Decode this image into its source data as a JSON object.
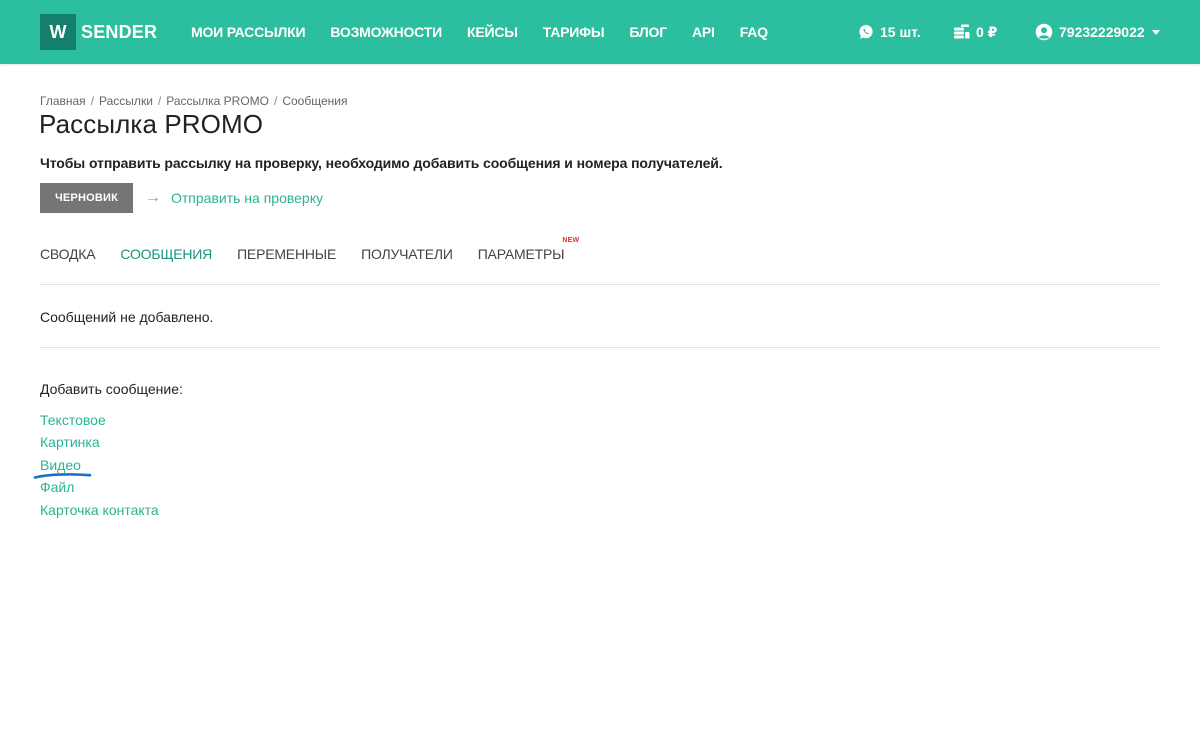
{
  "brand": {
    "logo_letter": "W",
    "name": "SENDER"
  },
  "nav": [
    {
      "label": "МОИ РАССЫЛКИ"
    },
    {
      "label": "ВОЗМОЖНОСТИ"
    },
    {
      "label": "КЕЙСЫ"
    },
    {
      "label": "ТАРИФЫ"
    },
    {
      "label": "БЛОГ"
    },
    {
      "label": "API"
    },
    {
      "label": "FAQ"
    }
  ],
  "header_stats": {
    "whatsapp_count": "15 шт.",
    "balance": "0 ₽",
    "user_phone": "79232229022"
  },
  "icons": {
    "whatsapp": "whatsapp-icon",
    "balance": "coins-icon",
    "user": "user-circle-icon",
    "arrow": "arrow-right-icon"
  },
  "breadcrumb": [
    "Главная",
    "Рассылки",
    "Рассылка PROMO",
    "Сообщения"
  ],
  "breadcrumb_separator": "/",
  "page_title": "Рассылка PROMO",
  "notice": "Чтобы отправить рассылку на проверку, необходимо добавить сообщения и номера получателей.",
  "status": {
    "badge": "ЧЕРНОВИК",
    "arrow": "→",
    "action": "Отправить на проверку"
  },
  "tabs": [
    {
      "label": "СВОДКА",
      "active": false
    },
    {
      "label": "СООБЩЕНИЯ",
      "active": true
    },
    {
      "label": "ПЕРЕМЕННЫЕ",
      "active": false
    },
    {
      "label": "ПОЛУЧАТЕЛИ",
      "active": false
    },
    {
      "label": "ПАРАМЕТРЫ",
      "active": false,
      "badge": "NEW"
    }
  ],
  "messages": {
    "empty_text": "Сообщений не добавлено."
  },
  "add_message": {
    "label": "Добавить сообщение:",
    "options": [
      "Текстовое",
      "Картинка",
      "Видео",
      "Файл",
      "Карточка контакта"
    ]
  },
  "colors": {
    "header_bg": "#2bbf9f",
    "logo_box": "#14806b",
    "accent_link": "#2bb394",
    "active_tab": "#18957b",
    "badge_bg": "#757575",
    "new_badge": "#e03030",
    "annotation": "#1a6fc4"
  }
}
